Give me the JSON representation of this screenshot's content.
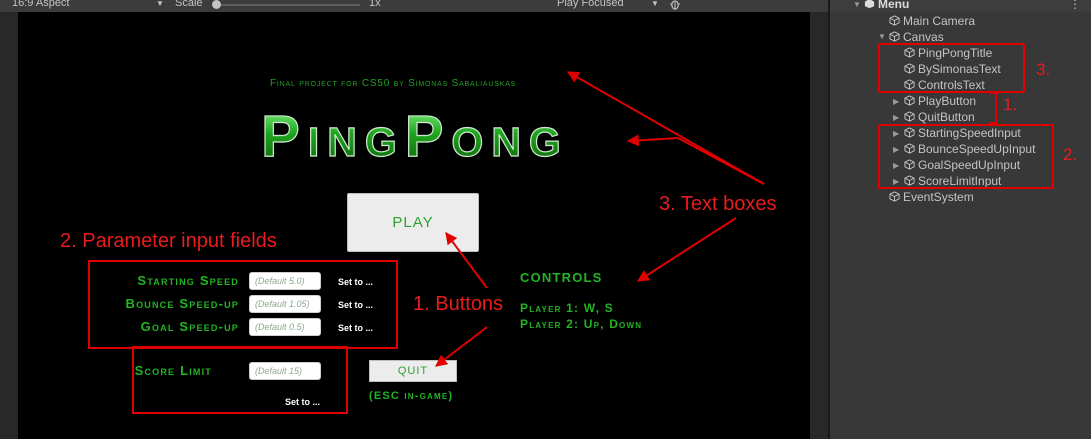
{
  "toolbar": {
    "aspect": "16:9 Aspect",
    "scale_label": "Scale",
    "scale_value": "1x",
    "scale_level": 0.0,
    "play_mode": "Play Focused",
    "debug_icon": "bug-icon"
  },
  "game": {
    "subtitle": "Final project for CS50 by Simonas Sabaliauskas",
    "title": "PingPong",
    "play_button": "PLAY",
    "quit_button": "QUIT",
    "esc_note": "(ESC in-game)",
    "params": [
      {
        "label": "Starting Speed",
        "placeholder": "(Default 5.0)",
        "set_to": "Set to ..."
      },
      {
        "label": "Bounce Speed-up",
        "placeholder": "(Default 1.05)",
        "set_to": "Set to ..."
      },
      {
        "label": "Goal Speed-up",
        "placeholder": "(Default 0.5)",
        "set_to": "Set to ..."
      }
    ],
    "score": {
      "label": "Score Limit",
      "placeholder": "(Default 15)",
      "set_to": "Set to ..."
    },
    "controls": {
      "heading": "CONTROLS",
      "player1": "Player 1: W, S",
      "player2": "Player 2: Up, Down"
    },
    "colors": {
      "green": "#22b422",
      "annotation_red": "#e10000"
    }
  },
  "annotations": {
    "params": "2. Parameter input fields",
    "buttons": "1. Buttons",
    "text_boxes": "3. Text boxes",
    "hier_3": "3.",
    "hier_1": "1.",
    "hier_2": "2."
  },
  "hierarchy": {
    "scene": "Menu",
    "items": {
      "main_camera": "Main Camera",
      "canvas": "Canvas",
      "title": "PingPongTitle",
      "by": "BySimonasText",
      "controls": "ControlsText",
      "play": "PlayButton",
      "quit": "QuitButton",
      "starting": "StartingSpeedInput",
      "bounce": "BounceSpeedUpInput",
      "goal": "GoalSpeedUpInput",
      "score": "ScoreLimitInput",
      "event": "EventSystem"
    }
  }
}
